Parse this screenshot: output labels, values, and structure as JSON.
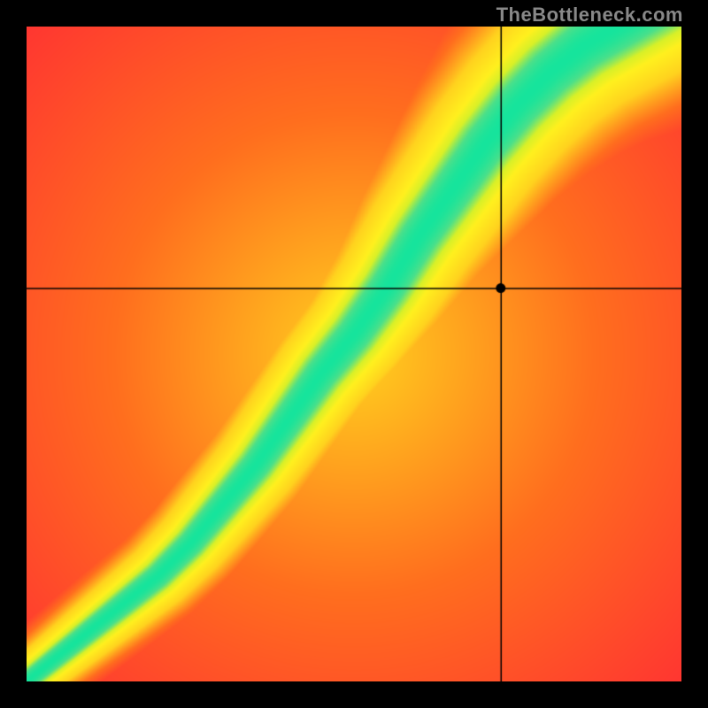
{
  "watermark": "TheBottleneck.com",
  "chart_data": {
    "type": "heatmap",
    "title": "",
    "xlabel": "",
    "ylabel": "",
    "xlim": [
      0,
      1
    ],
    "ylim": [
      0,
      1
    ],
    "crosshair": {
      "x": 0.725,
      "y": 0.6
    },
    "marker": {
      "x": 0.725,
      "y": 0.6
    },
    "ridge_path_x": [
      0.0,
      0.05,
      0.1,
      0.15,
      0.2,
      0.25,
      0.3,
      0.35,
      0.4,
      0.45,
      0.5,
      0.55,
      0.6,
      0.65,
      0.7,
      0.75,
      0.8,
      0.85,
      0.9,
      0.95,
      1.0
    ],
    "ridge_path_y": [
      0.0,
      0.04,
      0.08,
      0.12,
      0.16,
      0.21,
      0.27,
      0.33,
      0.4,
      0.47,
      0.53,
      0.6,
      0.68,
      0.75,
      0.82,
      0.88,
      0.93,
      0.97,
      1.0,
      1.03,
      1.06
    ],
    "color_scale": [
      {
        "v": 0.0,
        "color": "#ff143c"
      },
      {
        "v": 0.35,
        "color": "#ff6e1e"
      },
      {
        "v": 0.6,
        "color": "#ffd21e"
      },
      {
        "v": 0.8,
        "color": "#fff01e"
      },
      {
        "v": 0.88,
        "color": "#d8f028"
      },
      {
        "v": 0.95,
        "color": "#4be08a"
      },
      {
        "v": 1.0,
        "color": "#16e49c"
      }
    ],
    "field_description": "Value falls off with perpendicular distance from the curved ridge (green=on ridge, yellow=near, orange/red=far). Slight radial brightening toward center; corners away from ridge are reddest."
  }
}
